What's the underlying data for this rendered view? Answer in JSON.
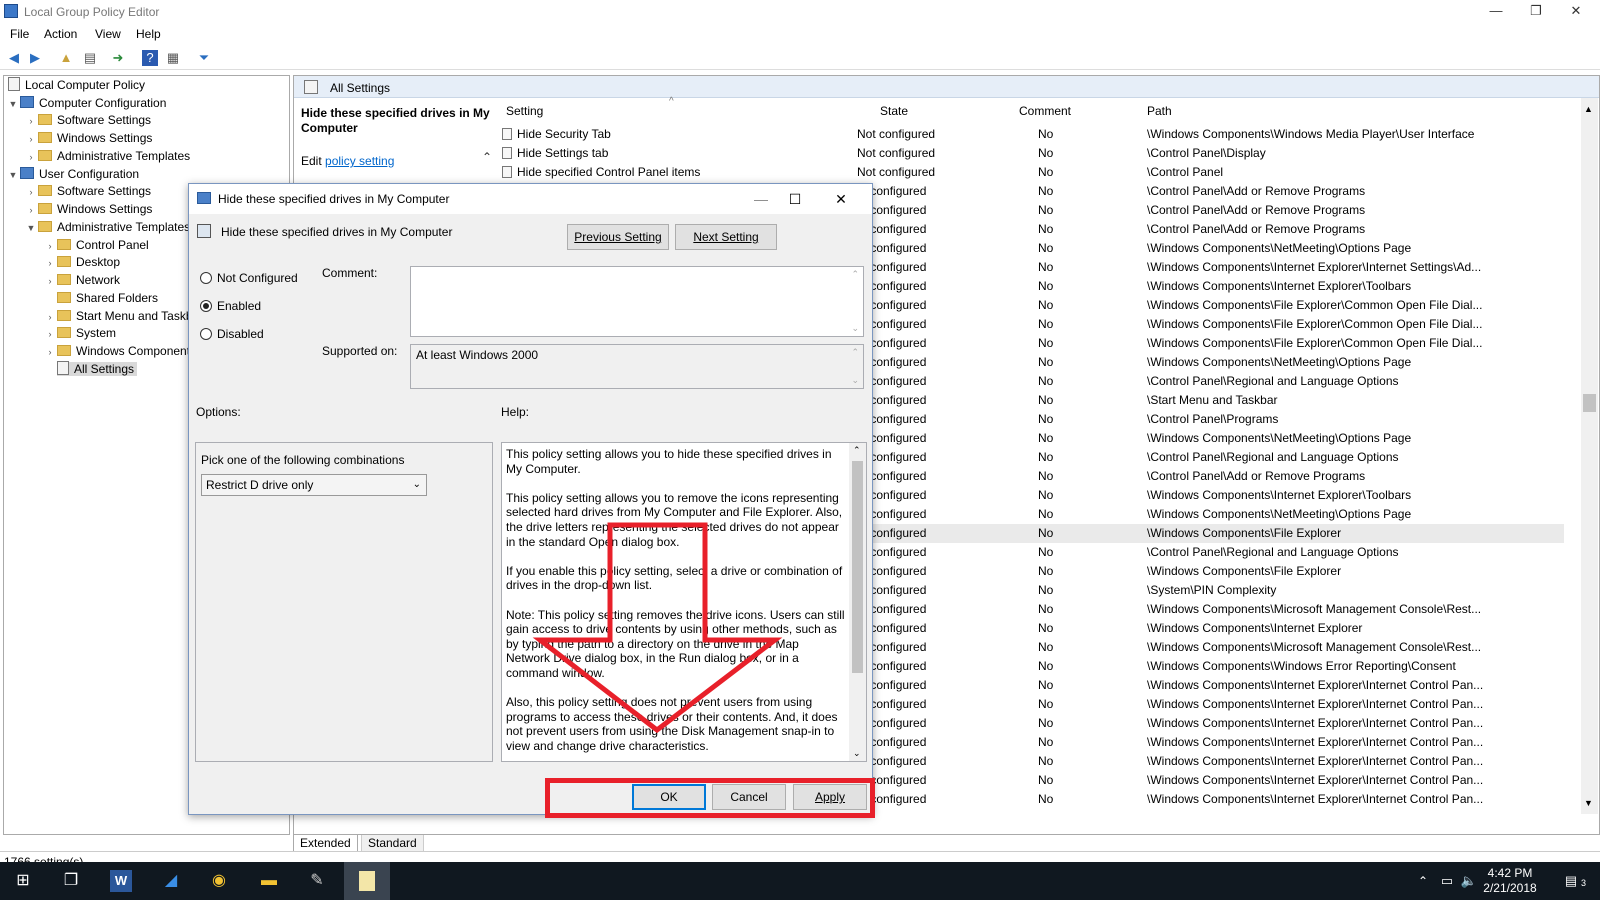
{
  "window": {
    "title": "Local Group Policy Editor",
    "min": "—",
    "max": "❐",
    "close": "✕"
  },
  "menu": [
    "File",
    "Action",
    "View",
    "Help"
  ],
  "tree": {
    "root": "Local Computer Policy",
    "items": [
      "Computer Configuration",
      "Software Settings",
      "Windows Settings",
      "Administrative Templates",
      "User Configuration",
      "Software Settings",
      "Windows Settings",
      "Administrative Templates",
      "Control Panel",
      "Desktop",
      "Network",
      "Shared Folders",
      "Start Menu and Taskbar",
      "System",
      "Windows Components",
      "All Settings"
    ]
  },
  "right": {
    "header": "All Settings",
    "ext_title": "Hide these specified drives in My Computer",
    "ext_edit_prefix": "Edit",
    "ext_edit_link": "policy setting",
    "columns": {
      "setting": "Setting",
      "state": "State",
      "comment": "Comment",
      "path": "Path"
    },
    "rows": [
      [
        "Hide Security Tab",
        "Not configured",
        "No",
        "\\Windows Components\\Windows Media Player\\User Interface"
      ],
      [
        "Hide Settings tab",
        "Not configured",
        "No",
        "\\Control Panel\\Display"
      ],
      [
        "Hide specified Control Panel items",
        "Not configured",
        "No",
        "\\Control Panel"
      ],
      [
        "",
        "ot configured",
        "No",
        "\\Control Panel\\Add or Remove Programs"
      ],
      [
        "",
        "ot configured",
        "No",
        "\\Control Panel\\Add or Remove Programs"
      ],
      [
        "",
        "ot configured",
        "No",
        "\\Control Panel\\Add or Remove Programs"
      ],
      [
        "",
        "ot configured",
        "No",
        "\\Windows Components\\NetMeeting\\Options Page"
      ],
      [
        "",
        "ot configured",
        "No",
        "\\Windows Components\\Internet Explorer\\Internet Settings\\Ad..."
      ],
      [
        "",
        "ot configured",
        "No",
        "\\Windows Components\\Internet Explorer\\Toolbars"
      ],
      [
        "",
        "ot configured",
        "No",
        "\\Windows Components\\File Explorer\\Common Open File Dial..."
      ],
      [
        "",
        "ot configured",
        "No",
        "\\Windows Components\\File Explorer\\Common Open File Dial..."
      ],
      [
        "",
        "ot configured",
        "No",
        "\\Windows Components\\File Explorer\\Common Open File Dial..."
      ],
      [
        "",
        "ot configured",
        "No",
        "\\Windows Components\\NetMeeting\\Options Page"
      ],
      [
        "",
        "ot configured",
        "No",
        "\\Control Panel\\Regional and Language Options"
      ],
      [
        "",
        "ot configured",
        "No",
        "\\Start Menu and Taskbar"
      ],
      [
        "",
        "ot configured",
        "No",
        "\\Control Panel\\Programs"
      ],
      [
        "",
        "ot configured",
        "No",
        "\\Windows Components\\NetMeeting\\Options Page"
      ],
      [
        "",
        "ot configured",
        "No",
        "\\Control Panel\\Regional and Language Options"
      ],
      [
        "",
        "ot configured",
        "No",
        "\\Control Panel\\Add or Remove Programs"
      ],
      [
        "",
        "ot configured",
        "No",
        "\\Windows Components\\Internet Explorer\\Toolbars"
      ],
      [
        "",
        "ot configured",
        "No",
        "\\Windows Components\\NetMeeting\\Options Page"
      ],
      [
        "",
        "ot configured",
        "No",
        "\\Windows Components\\File Explorer"
      ],
      [
        "",
        "ot configured",
        "No",
        "\\Control Panel\\Regional and Language Options"
      ],
      [
        "",
        "ot configured",
        "No",
        "\\Windows Components\\File Explorer"
      ],
      [
        "",
        "ot configured",
        "No",
        "\\System\\PIN Complexity"
      ],
      [
        "",
        "ot configured",
        "No",
        "\\Windows Components\\Microsoft Management Console\\Rest..."
      ],
      [
        "",
        "ot configured",
        "No",
        "\\Windows Components\\Internet Explorer"
      ],
      [
        "",
        "ot configured",
        "No",
        "\\Windows Components\\Microsoft Management Console\\Rest..."
      ],
      [
        "",
        "ot configured",
        "No",
        "\\Windows Components\\Windows Error Reporting\\Consent"
      ],
      [
        "",
        "ot configured",
        "No",
        "\\Windows Components\\Internet Explorer\\Internet Control Pan..."
      ],
      [
        "",
        "ot configured",
        "No",
        "\\Windows Components\\Internet Explorer\\Internet Control Pan..."
      ],
      [
        "",
        "ot configured",
        "No",
        "\\Windows Components\\Internet Explorer\\Internet Control Pan..."
      ],
      [
        "",
        "ot configured",
        "No",
        "\\Windows Components\\Internet Explorer\\Internet Control Pan..."
      ],
      [
        "",
        "ot configured",
        "No",
        "\\Windows Components\\Internet Explorer\\Internet Control Pan..."
      ],
      [
        "",
        "ot configured",
        "No",
        "\\Windows Components\\Internet Explorer\\Internet Control Pan..."
      ],
      [
        "",
        "ot configured",
        "No",
        "\\Windows Components\\Internet Explorer\\Internet Control Pan..."
      ]
    ],
    "highlight_row": 21
  },
  "tabs": [
    "Extended",
    "Standard"
  ],
  "status": "1766 setting(s)",
  "dialog": {
    "title": "Hide these specified drives in My Computer",
    "subtitle": "Hide these specified drives in My Computer",
    "prev": "Previous Setting",
    "next": "Next Setting",
    "radios": [
      "Not Configured",
      "Enabled",
      "Disabled"
    ],
    "selected_radio": 1,
    "comment_label": "Comment:",
    "supported_label": "Supported on:",
    "supported_value": "At least Windows 2000",
    "options_label": "Options:",
    "help_label": "Help:",
    "options_prompt": "Pick one of the following combinations",
    "options_value": "Restrict D drive only",
    "help": [
      "This policy setting allows you to hide these specified drives in My Computer.",
      "This policy setting allows you to remove the icons representing selected hard drives from My Computer and File Explorer. Also, the drive letters representing the selected drives do not appear in the standard Open dialog box.",
      "If you enable this policy setting, select a drive or combination of drives in the drop-down list.",
      "Note: This policy setting removes the drive icons. Users can still gain access to drive contents by using other methods, such as by typing the path to a directory on the drive in the Map Network Drive dialog box, in the Run dialog box, or in a command window.",
      "Also, this policy setting does not prevent users from using programs to access these drives or their contents. And, it does not prevent users from using the Disk Management snap-in to view and change drive characteristics."
    ],
    "ok": "OK",
    "cancel": "Cancel",
    "apply": "Apply"
  },
  "taskbar": {
    "time": "4:42 PM",
    "date": "2/21/2018",
    "notif": "3"
  },
  "colors": {
    "annotation": "#e8202a",
    "accent": "#0078d7"
  }
}
